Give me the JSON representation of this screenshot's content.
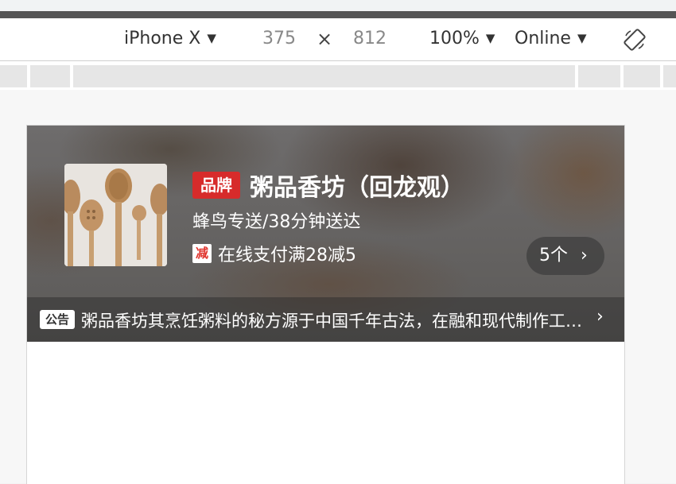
{
  "devtools": {
    "device": "iPhone X",
    "width": "375",
    "times": "×",
    "height": "812",
    "zoom": "100%",
    "network": "Online",
    "caret": "▼"
  },
  "shop": {
    "brand_badge": "品牌",
    "name": "粥品香坊（回龙观）",
    "delivery": "蜂鸟专送/38分钟送达",
    "promo_icon": "减",
    "promo_text": "在线支付满28减5",
    "promo_count": "5个",
    "promo_chevron": "›",
    "notice_badge": "公告",
    "notice_text": "粥品香坊其烹饪粥料的秘方源于中国千年古法，在融和现代制作工艺，由世界烹饪大师屈浩先生领衔研发。",
    "notice_chevron": "›"
  },
  "colors": {
    "brand_red": "#d72b2b",
    "promo_red": "#e0342d"
  }
}
